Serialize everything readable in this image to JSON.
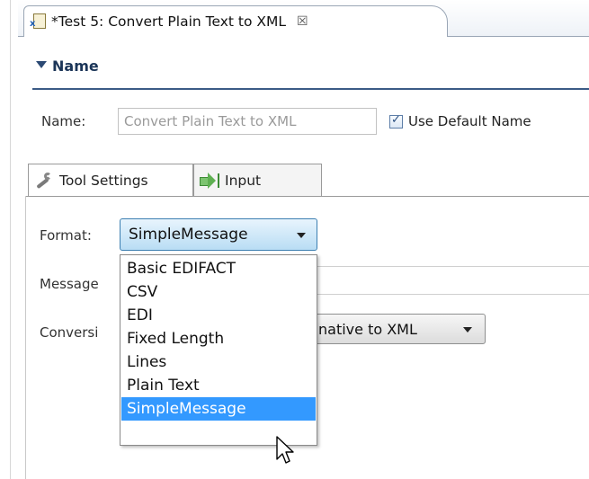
{
  "editor": {
    "tab_title": "*Test 5: Convert Plain Text to XML",
    "close_glyph": "☒"
  },
  "section": {
    "title": "Name"
  },
  "name_row": {
    "label": "Name:",
    "value": "Convert Plain Text to XML",
    "checkbox_label": "Use Default Name",
    "checkbox_checked": true
  },
  "tabs": [
    {
      "label": "Tool Settings",
      "icon": "wrench-icon",
      "active": true
    },
    {
      "label": "Input",
      "icon": "input-arrow-icon",
      "active": false
    }
  ],
  "format": {
    "label": "Format:",
    "selected": "SimpleMessage",
    "options": [
      "Basic EDIFACT",
      "CSV",
      "EDI",
      "Fixed Length",
      "Lines",
      "Plain Text",
      "SimpleMessage"
    ],
    "highlighted_index": 6
  },
  "message": {
    "label": "Message"
  },
  "conversion": {
    "label": "Conversi",
    "value": "native to XML"
  },
  "colors": {
    "accent": "#3399ff",
    "section_rule": "#3b5b86"
  }
}
